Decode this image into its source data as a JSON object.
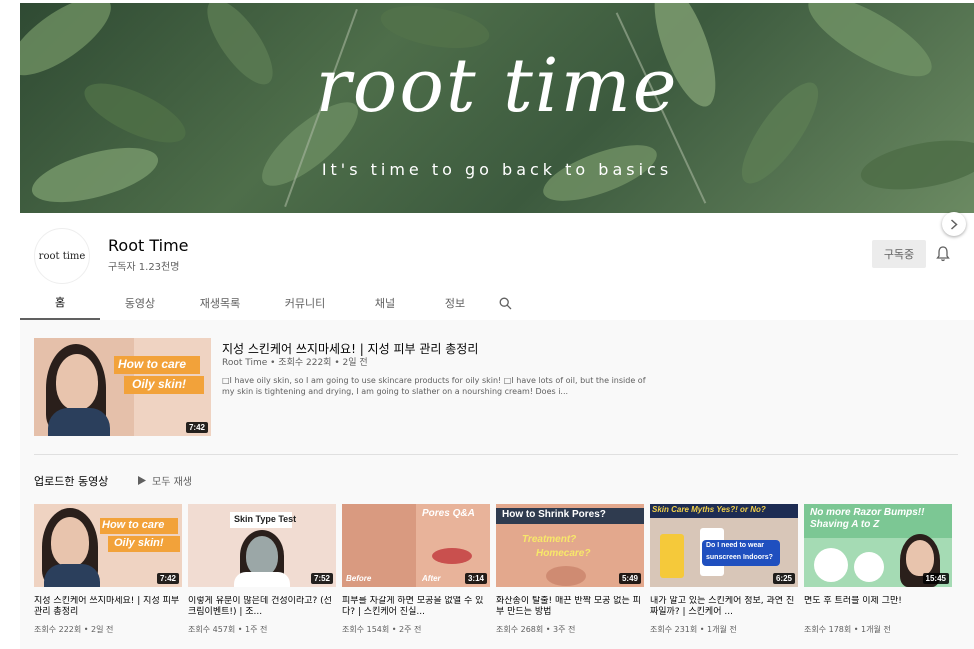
{
  "banner": {
    "title": "root time",
    "subtitle": "It's time to go back to basics"
  },
  "channel": {
    "avatar_text": "root time",
    "name": "Root Time",
    "subscribers": "구독자 1.23천명",
    "subscribed_label": "구독중"
  },
  "tabs": [
    {
      "label": "홈",
      "active": true
    },
    {
      "label": "동영상",
      "active": false
    },
    {
      "label": "재생목록",
      "active": false
    },
    {
      "label": "커뮤니티",
      "active": false
    },
    {
      "label": "채널",
      "active": false
    },
    {
      "label": "정보",
      "active": false
    }
  ],
  "featured": {
    "title": "지성 스킨케어 쓰지마세요! | 지성 피부 관리 총정리",
    "meta": "Root Time • 조회수 222회 • 2일 전",
    "description": "□I have oily skin, so I am going to use skincare products for oily skin! □I have lots of oil, but the inside of my skin is tightening and drying, I am going to slather on a nourshing cream! Does i...",
    "duration": "7:42",
    "thumb_caption1": "How to care",
    "thumb_caption2": "Oily skin!"
  },
  "uploads": {
    "section_title": "업로드한 동영상",
    "play_all_label": "모두 재생",
    "videos": [
      {
        "title": "지성 스킨케어 쓰지마세요! | 지성 피부 관리 총정리",
        "meta": "조회수 222회 • 2일 전",
        "duration": "7:42",
        "caption": "How to care\nOily skin!"
      },
      {
        "title": "이렇게 유분이 많은데 건성이라고? (선크림이벤트!) | 조...",
        "meta": "조회수 457회 • 1주 전",
        "duration": "7:52",
        "caption": "Skin Type Test"
      },
      {
        "title": "피부를 자갈게 하면 모공을 없앨 수 있다? | 스킨케어 진실...",
        "meta": "조회수 154회 • 2주 전",
        "duration": "3:14",
        "caption": "Pores Q&A"
      },
      {
        "title": "화산송이 탈출! 매끈 반짝 모공 없는 피부 만드는 방법",
        "meta": "조회수 268회 • 3주 전",
        "duration": "5:49",
        "caption": "How to Shrink Pores?"
      },
      {
        "title": "내가 알고 있는 스킨케어 정보, 과연 진짜일까? | 스킨케어 ...",
        "meta": "조회수 231회 • 1개월 전",
        "duration": "6:25",
        "caption": "Skin Care Myths Yes?! or No?"
      },
      {
        "title": "면도 후 트러블 이제 그만!",
        "meta": "조회수 178회 • 1개월 전",
        "duration": "15:45",
        "caption": "No more Razor Bumps!! Shaving A to Z"
      }
    ]
  },
  "thumb_text": {
    "t2_a": "Skin Type Test",
    "t3_b": "Before",
    "t3_c": "After",
    "t4_b": "Treatment?",
    "t4_c": "Homecare?",
    "t5_b": "Do I need to wear",
    "t5_c": "sunscreen Indoors?"
  }
}
